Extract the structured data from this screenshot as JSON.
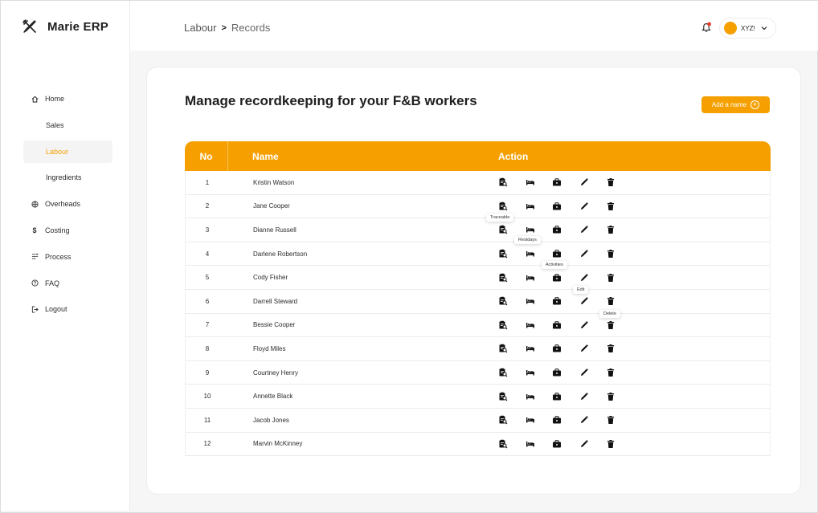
{
  "app": {
    "name": "Marie ERP"
  },
  "sidebar": {
    "items": [
      {
        "label": "Home",
        "icon": "home-icon"
      },
      {
        "label": "Sales",
        "icon": ""
      },
      {
        "label": "Labour",
        "icon": ""
      },
      {
        "label": "Ingredients",
        "icon": ""
      },
      {
        "label": "Overheads",
        "icon": "globe-icon"
      },
      {
        "label": "Costing",
        "icon": "dollar-icon"
      },
      {
        "label": "Process",
        "icon": "process-icon"
      },
      {
        "label": "FAQ",
        "icon": "question-icon"
      },
      {
        "label": "Logout",
        "icon": "logout-icon"
      }
    ]
  },
  "header": {
    "breadcrumb": {
      "parent": "Labour",
      "separator": ">",
      "current": "Records"
    },
    "user": {
      "name": "XYZ!"
    }
  },
  "main": {
    "title": "Manage recordkeeping for your F&B workers",
    "add_button": "Add a name"
  },
  "table": {
    "columns": {
      "no": "No",
      "name": "Name",
      "action": "Action"
    },
    "rows": [
      {
        "no": "1",
        "name": "Kristin Watson"
      },
      {
        "no": "2",
        "name": "Jane Cooper"
      },
      {
        "no": "3",
        "name": "Dianne Russell"
      },
      {
        "no": "4",
        "name": "Darlene Robertson"
      },
      {
        "no": "5",
        "name": "Cody Fisher"
      },
      {
        "no": "6",
        "name": "Darrell Steward"
      },
      {
        "no": "7",
        "name": "Bessie Cooper"
      },
      {
        "no": "8",
        "name": "Floyd Miles"
      },
      {
        "no": "9",
        "name": "Courtney Henry"
      },
      {
        "no": "10",
        "name": "Annette Black"
      },
      {
        "no": "11",
        "name": "Jacob Jones"
      },
      {
        "no": "12",
        "name": "Marvin McKinney"
      }
    ]
  },
  "tooltips": {
    "traceable": "Traceable",
    "restdays": "Restdays",
    "activities": "Activities",
    "edit": "Edit",
    "delete": "Delete"
  },
  "colors": {
    "accent": "#f5a000",
    "active_nav_bg": "#f4f4f5"
  }
}
